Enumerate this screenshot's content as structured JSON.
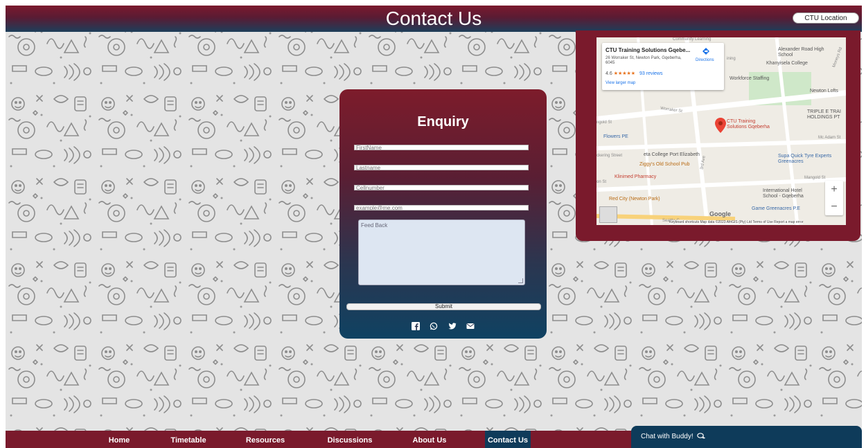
{
  "header": {
    "title": "Contact Us",
    "location_button": "CTU Location"
  },
  "form": {
    "title": "Enquiry",
    "fields": {
      "firstname_placeholder": "FirstName",
      "lastname_placeholder": "Lastname",
      "cellnumber_placeholder": "Cellnumber",
      "email_placeholder": "example@me.com",
      "feedback_placeholder": "Feed Back"
    },
    "submit_label": "Submit",
    "socials": [
      "facebook-icon",
      "whatsapp-icon",
      "twitter-icon",
      "email-icon"
    ]
  },
  "map": {
    "place_name": "CTU Training Solutions Gqebe...",
    "address": "26 Worraker St, Newton Park, Gqeberha, 6045",
    "rating": "4.6",
    "stars": "★★★★★",
    "reviews": "93 reviews",
    "larger_map": "View larger map",
    "directions": "Directions",
    "pin_label": "CTU Training Solutions Gqeberha",
    "labels": {
      "community": "Community Learning",
      "alexander": "Alexander Road High School",
      "khanyisela": "Khanyisela College",
      "workforce": "Workforce Staffing",
      "newton_lofts": "Newton Lofts",
      "triple_e": "TRIPLE E TRAI HOLDINGS PT",
      "flowers": "Flowers PE",
      "college": "eta College Port Elizabeth",
      "ziggys": "Ziggy's Old School Pub",
      "klinimed": "Klinimed Pharmacy",
      "supa": "Supa Quick Tyre Experts Greenacres",
      "international": "International Hotel School - Gqeberha",
      "red_city": "Red City (Newton Park)",
      "game": "Game Greenacres P.E",
      "worraker": "Worraker St",
      "gold": "ngold St",
      "mcadam": "Mc Adam St",
      "mangold": "Mangold St",
      "hickering": "ckering Street",
      "seattle": "Seattle C",
      "third": "3rd Ave",
      "leonst": "on St",
      "ining": "ining",
      "moneys": "Moneys Rd"
    },
    "google": "Google",
    "attribution": "Keyboard shortcuts   Map data ©2023 AfriGIS (Pty) Ltd   Terms of Use   Report a map error",
    "zoom_in": "+",
    "zoom_out": "−"
  },
  "nav": {
    "items": [
      {
        "label": "Home",
        "active": false
      },
      {
        "label": "Timetable",
        "active": false
      },
      {
        "label": "Resources",
        "active": false
      },
      {
        "label": "Discussions",
        "active": false
      },
      {
        "label": "About Us",
        "active": false
      },
      {
        "label": "Contact Us",
        "active": true
      }
    ]
  },
  "chat": {
    "label": "Chat with Buddy!",
    "icon": "chat-bubble-icon"
  },
  "colors": {
    "maroon": "#7a1a2c",
    "navy": "#0f3b5a",
    "page_bg": "#e4e4e4"
  }
}
